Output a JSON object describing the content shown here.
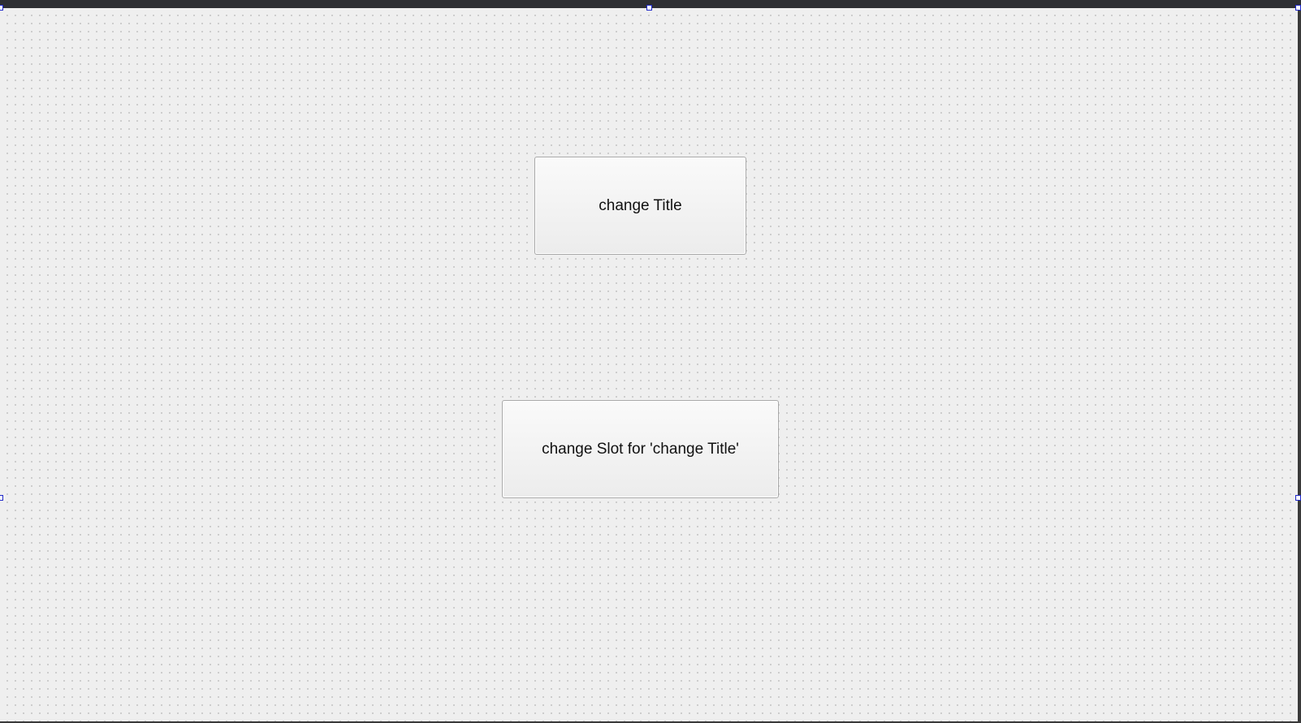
{
  "buttons": {
    "change_title_label": "change Title",
    "change_slot_label": "change Slot for 'change Title'"
  },
  "colors": {
    "canvas_background": "#efefef",
    "grid_dot": "#c8c8c8",
    "selection_handle": "#1f28c8",
    "top_bar": "#2e2f33"
  }
}
